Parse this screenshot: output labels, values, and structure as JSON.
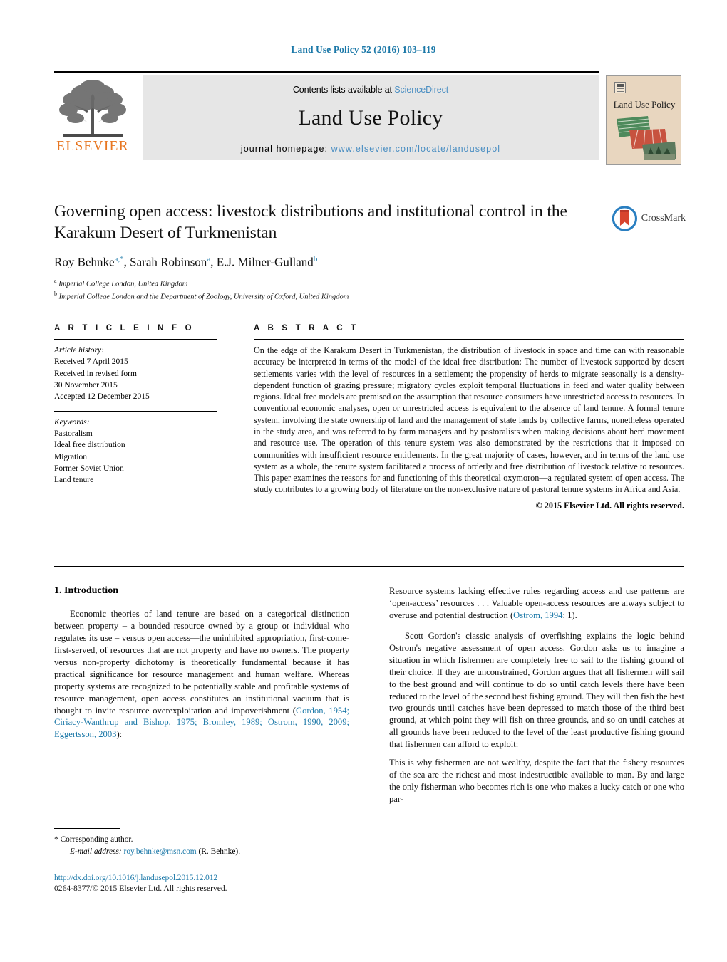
{
  "running_head": "Land Use Policy 52 (2016) 103–119",
  "masthead": {
    "contents_prefix": "Contents lists available at ",
    "sciencedirect": "ScienceDirect",
    "journal_title": "Land Use Policy",
    "homepage_label": "journal homepage: ",
    "homepage_url": "www.elsevier.com/locate/landusepol",
    "publisher_wordmark": "ELSEVIER",
    "cover_title": "Land Use Policy",
    "link_color": "#4a8ec2",
    "wordmark_color": "#e87722",
    "cover_bg": "#e8d6bf"
  },
  "crossmark": {
    "label": "CrossMark",
    "ring_color": "#2a7fc1",
    "mark_color": "#d8442f"
  },
  "article": {
    "title": "Governing open access: livestock distributions and institutional control in the Karakum Desert of Turkmenistan",
    "authors": [
      {
        "name": "Roy Behnke",
        "marks": "a,*"
      },
      {
        "name": "Sarah Robinson",
        "marks": "a"
      },
      {
        "name": "E.J. Milner-Gulland",
        "marks": "b"
      }
    ],
    "affiliations": [
      {
        "mark": "a",
        "text": "Imperial College London, United Kingdom"
      },
      {
        "mark": "b",
        "text": "Imperial College London and the Department of Zoology, University of Oxford, United Kingdom"
      }
    ]
  },
  "article_info": {
    "heading": "A R T I C L E   I N F O",
    "history_label": "Article history:",
    "history": [
      "Received 7 April 2015",
      "Received in revised form",
      "30 November 2015",
      "Accepted 12 December 2015"
    ],
    "keywords_label": "Keywords:",
    "keywords": [
      "Pastoralism",
      "Ideal free distribution",
      "Migration",
      "Former Soviet Union",
      "Land tenure"
    ]
  },
  "abstract": {
    "heading": "A B S T R A C T",
    "text": "On the edge of the Karakum Desert in Turkmenistan, the distribution of livestock in space and time can with reasonable accuracy be interpreted in terms of the model of the ideal free distribution: The number of livestock supported by desert settlements varies with the level of resources in a settlement; the propensity of herds to migrate seasonally is a density-dependent function of grazing pressure; migratory cycles exploit temporal fluctuations in feed and water quality between regions. Ideal free models are premised on the assumption that resource consumers have unrestricted access to resources. In conventional economic analyses, open or unrestricted access is equivalent to the absence of land tenure. A formal tenure system, involving the state ownership of land and the management of state lands by collective farms, nonetheless operated in the study area, and was referred to by farm managers and by pastoralists when making decisions about herd movement and resource use. The operation of this tenure system was also demonstrated by the restrictions that it imposed on communities with insufficient resource entitlements. In the great majority of cases, however, and in terms of the land use system as a whole, the tenure system facilitated a process of orderly and free distribution of livestock relative to resources. This paper examines the reasons for and functioning of this theoretical oxymoron—a regulated system of open access. The study contributes to a growing body of literature on the non-exclusive nature of pastoral tenure systems in Africa and Asia.",
    "copyright": "© 2015 Elsevier Ltd. All rights reserved."
  },
  "body": {
    "section_number_title": "1.  Introduction",
    "left_para_1_a": "Economic theories of land tenure are based on a categorical distinction between property – a bounded resource owned by a group or individual who regulates its use – versus open access—the uninhibited appropriation, first-come-first-served, of resources that are not property and have no owners. The property versus non-property dichotomy is theoretically fundamental because it has practical significance for resource management and human welfare. Whereas property systems are recognized to be potentially stable and profitable systems of resource management, open access constitutes an institutional vacuum that is thought to invite resource overexploitation and impoverishment (",
    "left_para_1_refs": "Gordon, 1954; Ciriacy-Wanthrup and Bishop, 1975; Bromley, 1989; Ostrom, 1990, 2009; Eggertsson, 2003",
    "left_para_1_b": "):",
    "right_quote_1_a": "Resource systems lacking effective rules regarding access and use patterns are ‘open-access’ resources . . . Valuable open-access resources are always subject to overuse and potential destruction (",
    "right_quote_1_ref": "Ostrom, 1994",
    "right_quote_1_b": ": 1).",
    "right_para_2": "Scott Gordon's classic analysis of overfishing explains the logic behind Ostrom's negative assessment of open access. Gordon asks us to imagine a situation in which fishermen are completely free to sail to the fishing ground of their choice. If they are unconstrained, Gordon argues that all fishermen will sail to the best ground and will continue to do so until catch levels there have been reduced to the level of the second best fishing ground. They will then fish the best two grounds until catches have been depressed to match those of the third best ground, at which point they will fish on three grounds, and so on until catches at all grounds have been reduced to the level of the least productive fishing ground that fishermen can afford to exploit:",
    "right_quote_2": "This is why fishermen are not wealthy, despite the fact that the fishery resources of the sea are the richest and most indestructible available to man. By and large the only fisherman who becomes rich is one who makes a lucky catch or one who par-"
  },
  "footer": {
    "corresponding_marker": "*",
    "corresponding_label": "Corresponding author.",
    "email_label": "E-mail address:",
    "email": "roy.behnke@msn.com",
    "email_suffix": "(R. Behnke).",
    "doi": "http://dx.doi.org/10.1016/j.landusepol.2015.12.012",
    "issn_line": "0264-8377/© 2015 Elsevier Ltd. All rights reserved."
  }
}
